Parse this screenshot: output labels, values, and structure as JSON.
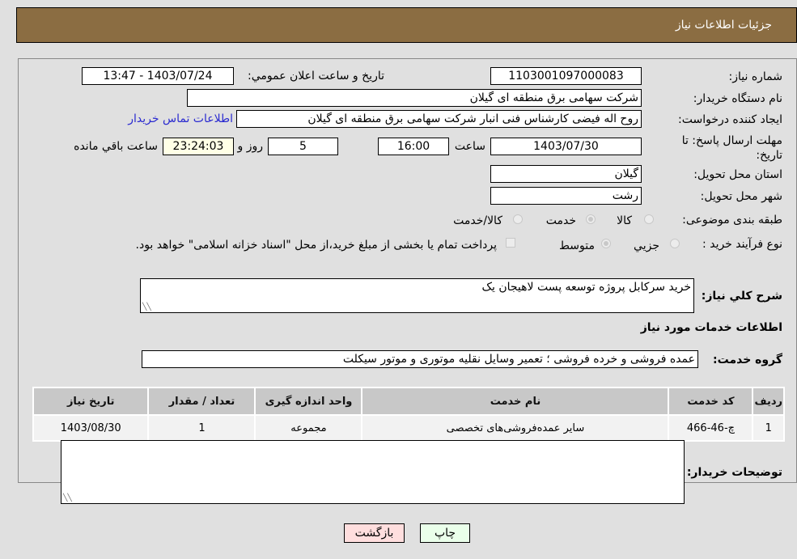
{
  "header": {
    "title": "جزئیات اطلاعات نیاز"
  },
  "form": {
    "need_number_label": "شماره نیاز:",
    "need_number": "1103001097000083",
    "announce_label": "تاريخ و ساعت اعلان عمومي:",
    "announce_value": "1403/07/24 - 13:47",
    "buyer_org_label": "نام دستگاه خريدار:",
    "buyer_org": "شرکت سهامی برق منطقه ای گیلان",
    "requester_label": "ايجاد کننده درخواست:",
    "requester": "روح اله فیضی کارشناس فنی انبار شرکت سهامی برق منطقه ای گیلان",
    "contact_link": "اطلاعات تماس خریدار",
    "deadline_label": "مهلت ارسال پاسخ: تا تاریخ:",
    "deadline_date": "1403/07/30",
    "time_label": "ساعت",
    "deadline_time": "16:00",
    "days_value": "5",
    "days_label": "روز و",
    "remaining_time": "23:24:03",
    "remaining_label": "ساعت باقي مانده",
    "province_label": "استان محل تحویل:",
    "province": "گیلان",
    "city_label": "شهر محل تحویل:",
    "city": "رشت",
    "category_label": "طبقه بندی موضوعی:",
    "category_options": [
      {
        "label": "کالا",
        "selected": false
      },
      {
        "label": "خدمت",
        "selected": true
      },
      {
        "label": "کالا/خدمت",
        "selected": false
      }
    ],
    "process_label": "نوع فرآیند خرید :",
    "process_options": [
      {
        "label": "جزيي",
        "selected": false
      },
      {
        "label": "متوسط",
        "selected": true
      }
    ],
    "treasury_note": "پرداخت تمام یا بخشی از مبلغ خرید،از محل \"اسناد خزانه اسلامی\" خواهد بود.",
    "description_label": "شرح کلي نیاز:",
    "description": "خرید سرکابل پروژه توسعه پست لاهیجان یک",
    "services_title": "اطلاعات خدمات مورد نیاز",
    "service_group_label": "گروه خدمت:",
    "service_group": "عمده فروشی و خرده فروشی ؛ تعمیر وسایل نقلیه موتوری و موتور سیکلت",
    "buyer_notes_label": "توضیحات خریدار:",
    "buyer_notes": ""
  },
  "table": {
    "headers": [
      "ردیف",
      "کد خدمت",
      "نام خدمت",
      "واحد اندازه گیری",
      "تعداد / مقدار",
      "تاریخ نیاز"
    ],
    "rows": [
      [
        "1",
        "چ-46-466",
        "سایر عمده‌فروشی‌های تخصصی",
        "مجموعه",
        "1",
        "1403/08/30"
      ]
    ]
  },
  "buttons": {
    "print": "چاپ",
    "back": "بازگشت"
  },
  "colors": {
    "header_bg": "#8b6d42",
    "print_bg": "#eaffea",
    "back_bg": "#ffdede"
  }
}
